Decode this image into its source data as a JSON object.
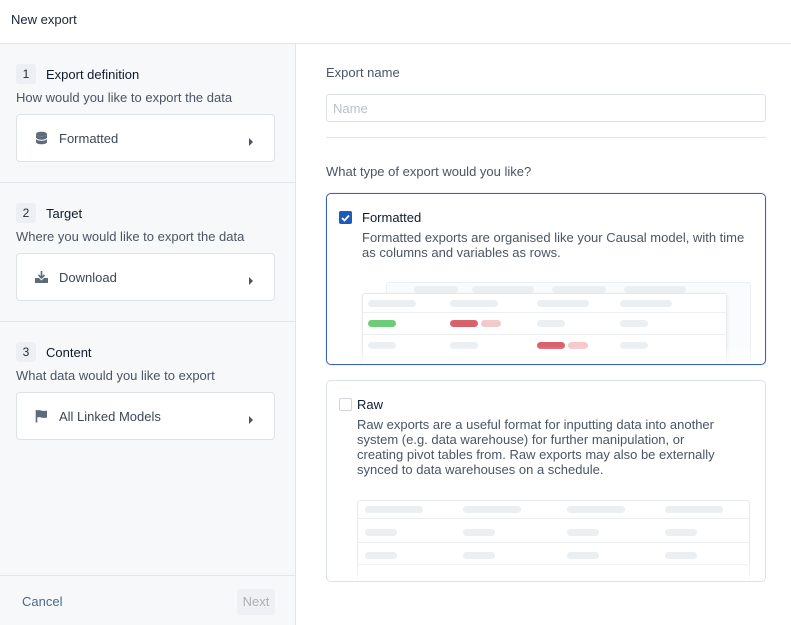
{
  "header": {
    "title": "New export"
  },
  "steps": [
    {
      "number": "1",
      "title": "Export definition",
      "description": "How would you like to export the data",
      "selection": "Formatted",
      "icon": "database-icon"
    },
    {
      "number": "2",
      "title": "Target",
      "description": "Where you would like to export the data",
      "selection": "Download",
      "icon": "download-icon"
    },
    {
      "number": "3",
      "title": "Content",
      "description": "What data would you like to export",
      "selection": "All Linked Models",
      "icon": "flag-icon"
    }
  ],
  "footer": {
    "cancel_label": "Cancel",
    "next_label": "Next"
  },
  "form": {
    "name_label": "Export name",
    "name_placeholder": "Name",
    "name_value": "",
    "type_question": "What type of export would you like?"
  },
  "options": [
    {
      "title": "Formatted",
      "checked": true,
      "description": "Formatted exports are organised like your Causal model, with time as columns and variables as rows."
    },
    {
      "title": "Raw",
      "checked": false,
      "description": "Raw exports are a useful format for inputting data into another system (e.g. data warehouse) for further manipulation, or creating pivot tables from. Raw exports may also be externally synced to data warehouses on a schedule."
    }
  ],
  "colors": {
    "accent": "#1e5bb8",
    "selected_border": "#3a63b8",
    "positive": "#6dcd76",
    "negative": "#d9616a"
  }
}
